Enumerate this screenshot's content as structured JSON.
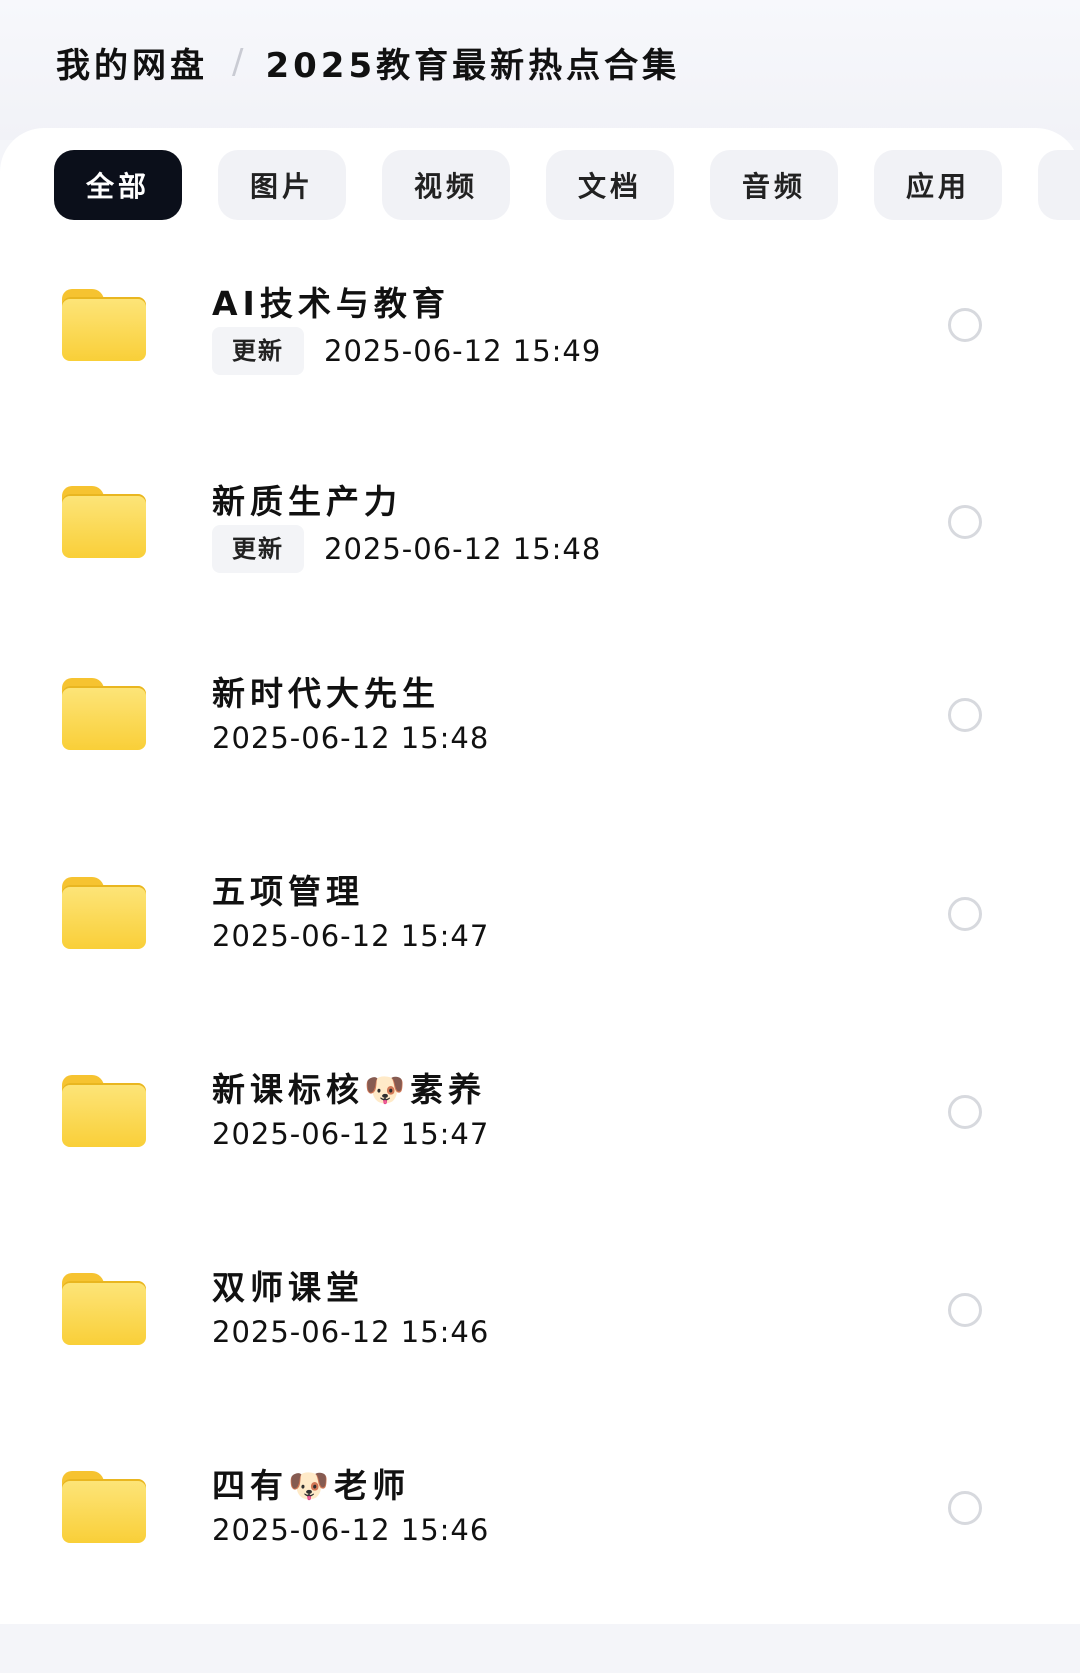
{
  "breadcrumb": {
    "root": "我的网盘",
    "separator": "/",
    "current": "2025教育最新热点合集"
  },
  "tabs": [
    {
      "label": "全部",
      "active": true
    },
    {
      "label": "图片",
      "active": false
    },
    {
      "label": "视频",
      "active": false
    },
    {
      "label": "文档",
      "active": false
    },
    {
      "label": "音频",
      "active": false
    },
    {
      "label": "应用",
      "active": false
    }
  ],
  "items": [
    {
      "name": "AI技术与教育",
      "badge": "更新",
      "datetime": "2025-06-12  15:49"
    },
    {
      "name": "新质生产力",
      "badge": "更新",
      "datetime": "2025-06-12  15:48"
    },
    {
      "name": "新时代大先生",
      "badge": "",
      "datetime": "2025-06-12  15:48"
    },
    {
      "name": "五项管理",
      "badge": "",
      "datetime": "2025-06-12  15:47"
    },
    {
      "name": "新课标核🐶素养",
      "badge": "",
      "datetime": "2025-06-12  15:47"
    },
    {
      "name": "双师课堂",
      "badge": "",
      "datetime": "2025-06-12  15:46"
    },
    {
      "name": "四有🐶老师",
      "badge": "",
      "datetime": "2025-06-12  15:46"
    }
  ],
  "icons": {
    "folder": "folder-icon",
    "select": "radio-circle-icon"
  },
  "colors": {
    "active_tab": "#0b0f1a",
    "folder": "#f9cf38"
  }
}
